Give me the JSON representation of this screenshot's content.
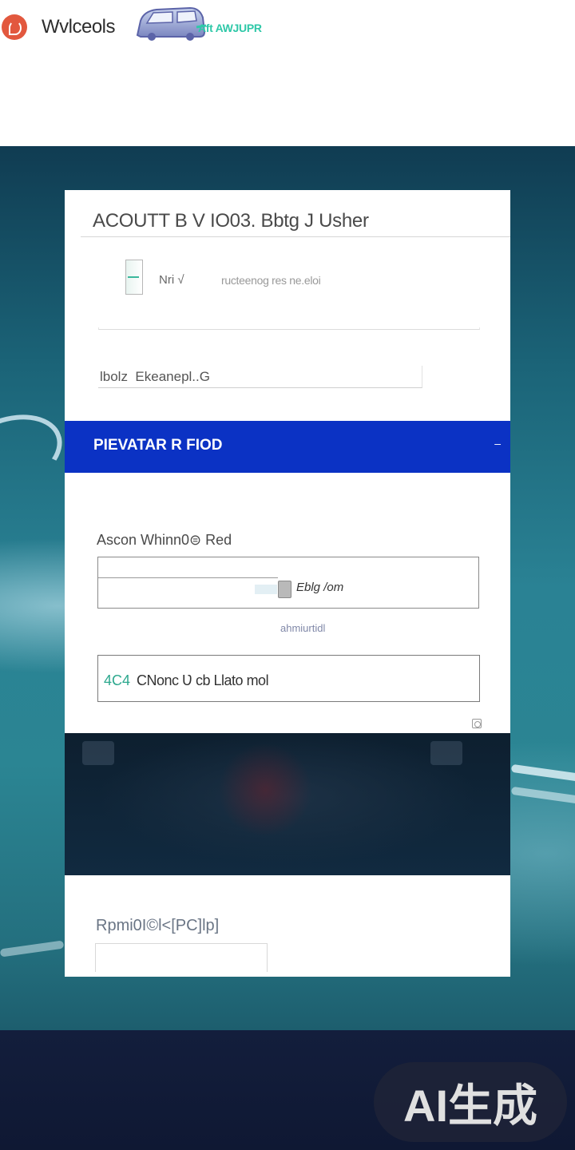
{
  "header": {
    "brand_name": "Wvlceols",
    "brand_tagline": "Aft AWJUPR",
    "badge_icon": "van-badge-icon",
    "logo_icon": "brand-logo-icon"
  },
  "card": {
    "title": "ACOUTT B V IO03. Bbtg  J  Usher",
    "row1": {
      "label": "Nri  √",
      "hint": "ructeenog  res  ne.eloi",
      "icon": "document-icon"
    },
    "field2": {
      "value": "lbolz  Ekeanepl..G"
    },
    "section": {
      "title": "PIEVATAR R FIOD",
      "toggle": "–"
    },
    "field3": {
      "label": "Ascon  Whinn0⊜ Red",
      "value": "Eblg /om",
      "hint": "ahmiurtidl"
    },
    "field4": {
      "prefix": "4C4",
      "text": "CNonc  Ʋ cb  Llato mol"
    },
    "field5": {
      "label": "Rpmi0I©l<[PC]lp]",
      "value": ""
    }
  },
  "watermark": "AI生成",
  "colors": {
    "accent_blue": "#0b32c4",
    "logo_red": "#e2583e",
    "tagline_green": "#2fc8a8",
    "footer_navy": "#131e3c"
  }
}
